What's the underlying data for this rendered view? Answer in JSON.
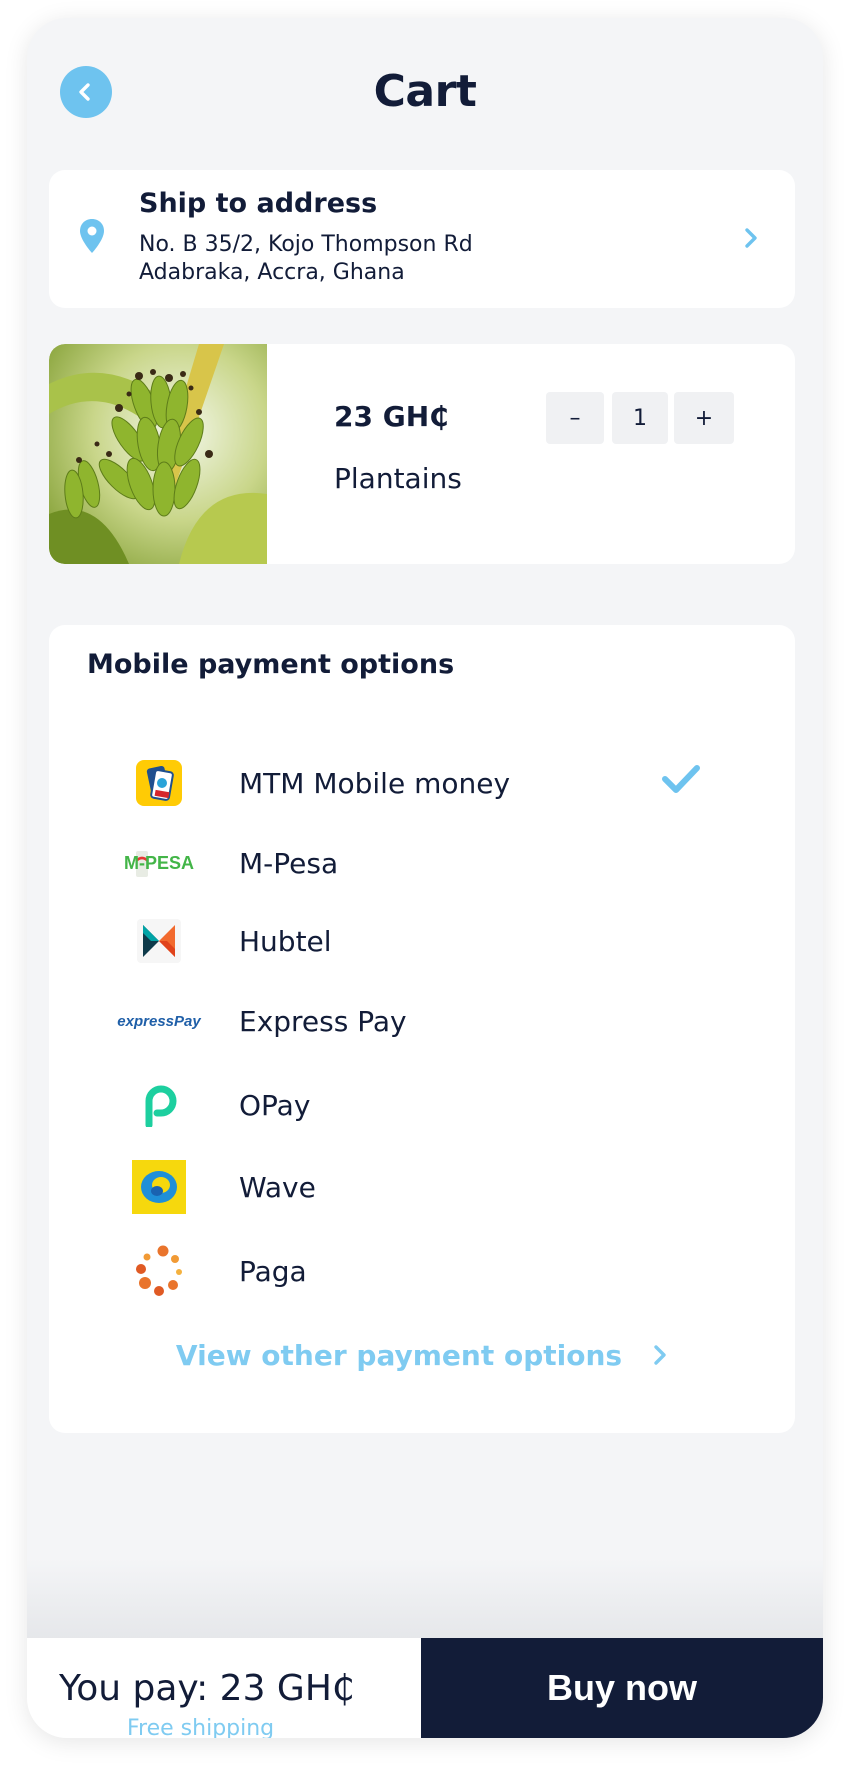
{
  "header": {
    "title": "Cart",
    "back_icon": "chevron-left-icon"
  },
  "address": {
    "title": "Ship to address",
    "line1": "No. B 35/2, Kojo Thompson Rd",
    "line2": "Adabraka, Accra, Ghana",
    "icon": "map-pin-icon"
  },
  "product": {
    "image": "plantains-photo",
    "price": "23 GH₵",
    "name": "Plantains",
    "qty_minus_label": "–",
    "qty_value": "1",
    "qty_plus_label": "+"
  },
  "payment": {
    "title": "Mobile payment options",
    "options": [
      {
        "label": "MTM Mobile money",
        "logo": "mtn-momo-logo",
        "selected": true
      },
      {
        "label": "M-Pesa",
        "logo": "mpesa-logo",
        "logo_text": "M-PESA",
        "selected": false
      },
      {
        "label": "Hubtel",
        "logo": "hubtel-logo",
        "selected": false
      },
      {
        "label": "Express Pay",
        "logo": "expresspay-logo",
        "logo_text": "expressPay",
        "selected": false
      },
      {
        "label": "OPay",
        "logo": "opay-logo",
        "selected": false
      },
      {
        "label": "Wave",
        "logo": "wave-logo",
        "selected": false
      },
      {
        "label": "Paga",
        "logo": "paga-logo",
        "selected": false
      }
    ],
    "view_other": "View other payment options"
  },
  "footer": {
    "you_pay": "You pay: 23 GH₵",
    "free_shipping": "Free shipping",
    "buy_now": "Buy now"
  },
  "colors": {
    "accent": "#6ec3ef",
    "dark": "#121c38",
    "background": "#f4f5f7"
  }
}
